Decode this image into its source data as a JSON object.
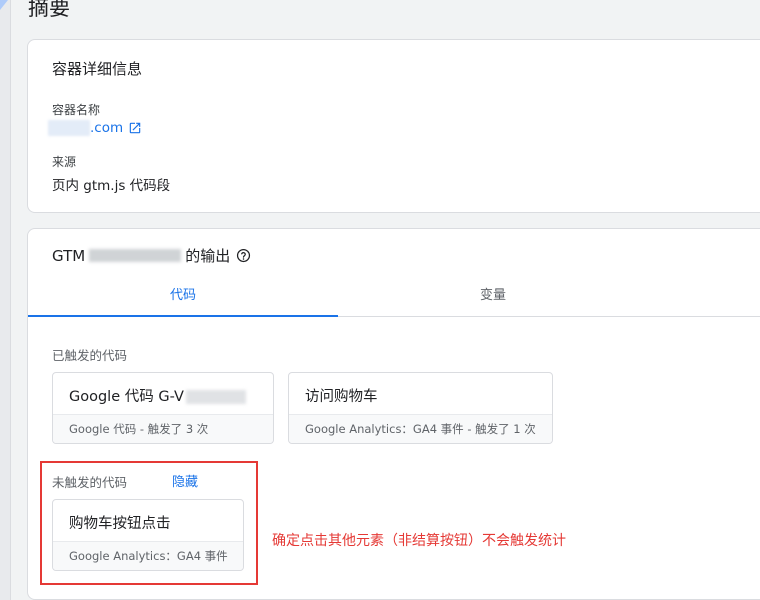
{
  "page": {
    "title": "摘要"
  },
  "details": {
    "title": "容器详细信息",
    "name_label": "容器名称",
    "name_value": ".com",
    "source_label": "来源",
    "source_value": "页内 gtm.js 代码段"
  },
  "output": {
    "title_prefix": "GTM",
    "title_suffix": "的输出",
    "tabs": [
      {
        "label": "代码"
      },
      {
        "label": "变量"
      }
    ],
    "fired": {
      "label": "已触发的代码",
      "tags": [
        {
          "name": "Google 代码 G-V",
          "meta": "Google 代码 - 触发了 3 次"
        },
        {
          "name": "访问购物车",
          "meta": "Google Analytics：GA4 事件 - 触发了 1 次"
        }
      ]
    },
    "not_fired": {
      "label": "未触发的代码",
      "hide_label": "隐藏",
      "tags": [
        {
          "name": "购物车按钮点击",
          "meta": "Google Analytics：GA4 事件"
        }
      ]
    }
  },
  "annotation": {
    "text": "确定点击其他元素（非结算按钮）不会触发统计",
    "color": "#e53935"
  },
  "colors": {
    "accent": "#1a73e8",
    "annotation": "#e53935"
  }
}
